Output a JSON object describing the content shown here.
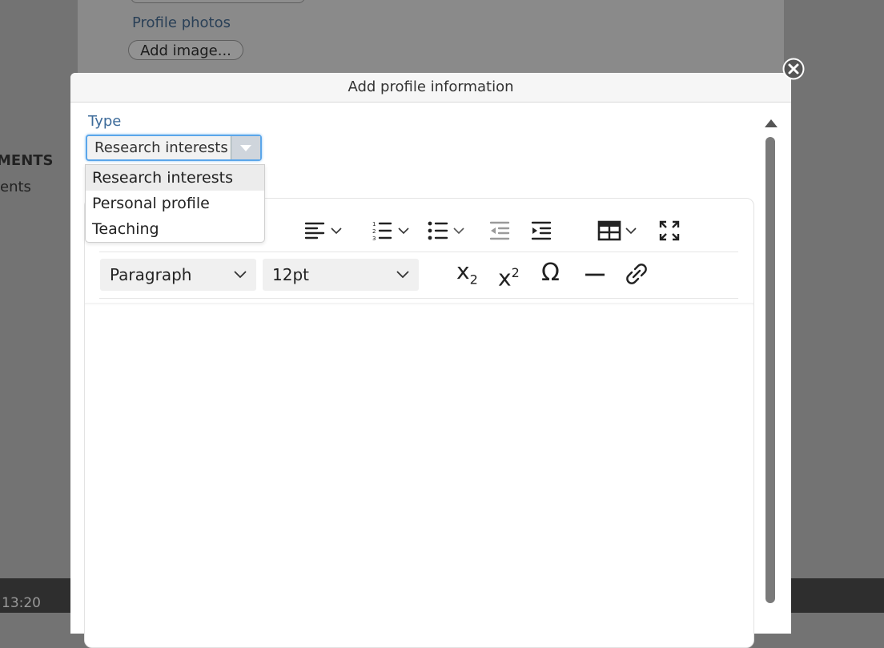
{
  "background": {
    "profile_photos_label": "Profile photos",
    "add_image_label": "Add image...",
    "sidebar_heading": "MENTS",
    "sidebar_item": "ents",
    "time": "13:20"
  },
  "dialog": {
    "title": "Add profile information",
    "type_label": "Type",
    "type_selected": "Research interests",
    "type_options": [
      "Research interests",
      "Personal profile",
      "Teaching"
    ]
  },
  "editor": {
    "block_format": "Paragraph",
    "font_size": "12pt",
    "subscript_label": "x",
    "subscript_sub": "2",
    "superscript_label": "x",
    "superscript_sup": "2",
    "special_char": "Ω"
  },
  "colors": {
    "accent_focus": "#5ba6ea",
    "label_blue": "#3d6b9a"
  }
}
